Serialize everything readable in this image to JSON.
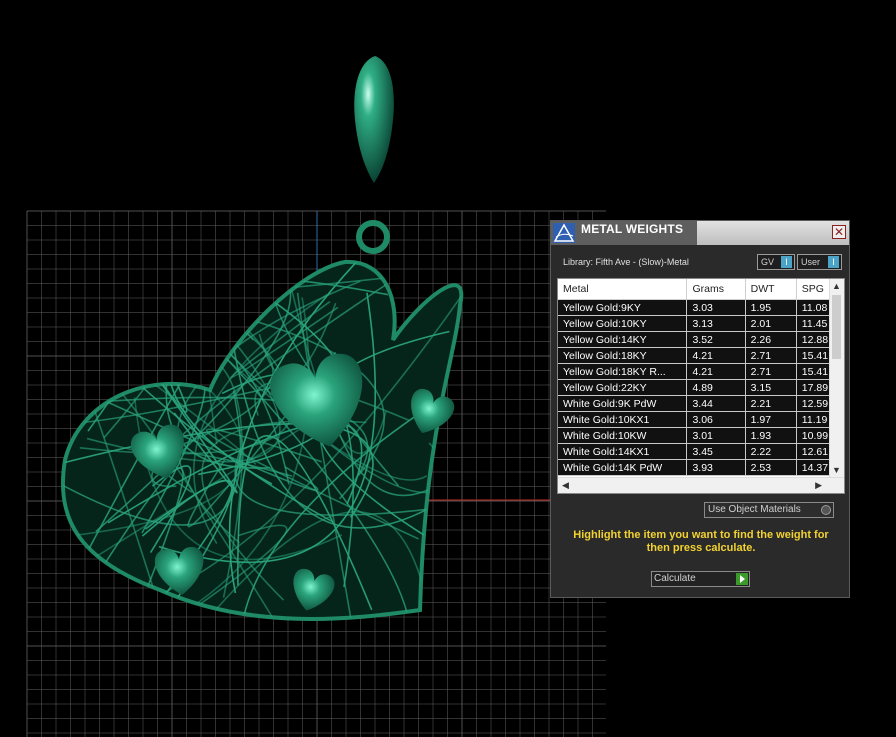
{
  "panel": {
    "title": "METAL WEIGHTS",
    "close_symbol": "✕",
    "library_label": "Library: Fifth Ave - (Slow)-Metal",
    "toggles": [
      {
        "label": "GV",
        "indicator": "I"
      },
      {
        "label": "User",
        "indicator": "I"
      }
    ],
    "table": {
      "headers": [
        "Metal",
        "Grams",
        "DWT",
        "SPG"
      ],
      "rows": [
        [
          "Yellow Gold:9KY",
          "3.03",
          "1.95",
          "11.08"
        ],
        [
          "Yellow Gold:10KY",
          "3.13",
          "2.01",
          "11.45"
        ],
        [
          "Yellow Gold:14KY",
          "3.52",
          "2.26",
          "12.88"
        ],
        [
          "Yellow Gold:18KY",
          "4.21",
          "2.71",
          "15.41"
        ],
        [
          "Yellow Gold:18KY R...",
          "4.21",
          "2.71",
          "15.41"
        ],
        [
          "Yellow Gold:22KY",
          "4.89",
          "3.15",
          "17.89"
        ],
        [
          "White Gold:9K PdW",
          "3.44",
          "2.21",
          "12.59"
        ],
        [
          "White Gold:10KX1",
          "3.06",
          "1.97",
          "11.19"
        ],
        [
          "White Gold:10KW",
          "3.01",
          "1.93",
          "10.99"
        ],
        [
          "White Gold:14KX1",
          "3.45",
          "2.22",
          "12.61"
        ],
        [
          "White Gold:14K PdW",
          "3.93",
          "2.53",
          "14.37"
        ]
      ]
    },
    "use_object_materials_label": "Use Object Materials",
    "instruction": "Highlight the item you want to find the weight for then press calculate.",
    "calculate_label": "Calculate"
  },
  "colors": {
    "background": "#000000",
    "model_green": "#1f8a66",
    "grid_line": "#5a5a5a",
    "axis_red": "#c0281e",
    "axis_blue": "#2a6ea8",
    "highlight_text": "#f2d230"
  }
}
